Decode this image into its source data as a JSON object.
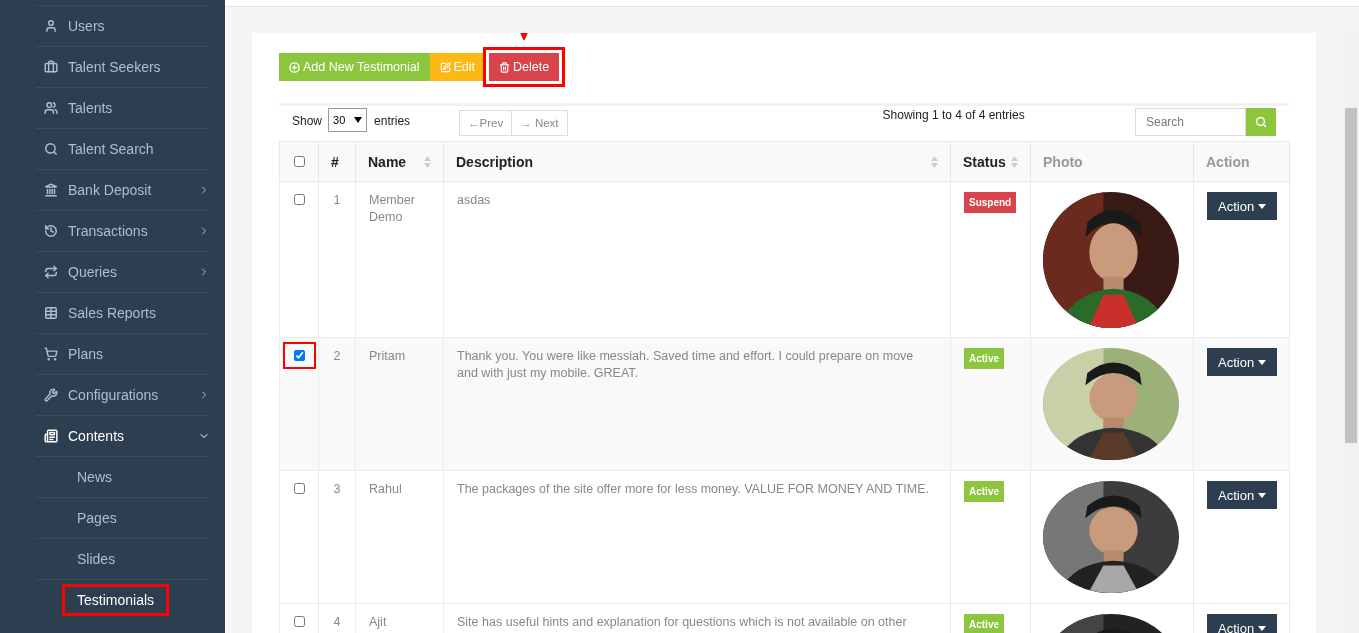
{
  "sidebar": {
    "items": [
      {
        "label": "Users",
        "submenu": false,
        "expanded": false
      },
      {
        "label": "Talent Seekers",
        "submenu": false,
        "expanded": false
      },
      {
        "label": "Talents",
        "submenu": false,
        "expanded": false
      },
      {
        "label": "Talent Search",
        "submenu": false,
        "expanded": false
      },
      {
        "label": "Bank Deposit",
        "submenu": true,
        "expanded": false
      },
      {
        "label": "Transactions",
        "submenu": true,
        "expanded": false
      },
      {
        "label": "Queries",
        "submenu": true,
        "expanded": false
      },
      {
        "label": "Sales Reports",
        "submenu": false,
        "expanded": false
      },
      {
        "label": "Plans",
        "submenu": false,
        "expanded": false
      },
      {
        "label": "Configurations",
        "submenu": true,
        "expanded": false
      },
      {
        "label": "Contents",
        "submenu": true,
        "expanded": true,
        "children": [
          {
            "label": "News",
            "selected": false,
            "highlighted": false
          },
          {
            "label": "Pages",
            "selected": false,
            "highlighted": false
          },
          {
            "label": "Slides",
            "selected": false,
            "highlighted": false
          },
          {
            "label": "Testimonials",
            "selected": true,
            "highlighted": true
          }
        ]
      }
    ]
  },
  "toolbar": {
    "buttons": [
      {
        "kind": "add",
        "label": "Add New Testimonial",
        "highlighted": false
      },
      {
        "kind": "edit",
        "label": "Edit",
        "highlighted": false
      },
      {
        "kind": "delete",
        "label": "Delete",
        "highlighted": true
      }
    ]
  },
  "controls": {
    "show_label": "Show",
    "page_size": "30",
    "entries_label": "entries",
    "prev": "←Prev",
    "next": "→ Next",
    "info": "Showing 1 to 4 of 4 entries",
    "search": {
      "placeholder": "Search"
    }
  },
  "table": {
    "columns": [
      {
        "kind": "checkbox",
        "checked": false
      },
      {
        "kind": "text",
        "label": "#",
        "sortable": false,
        "muted": false
      },
      {
        "kind": "text",
        "label": "Name",
        "sortable": true,
        "muted": false
      },
      {
        "kind": "text",
        "label": "Description",
        "sortable": true,
        "muted": false
      },
      {
        "kind": "text",
        "label": "Status",
        "sortable": true,
        "muted": false
      },
      {
        "kind": "text",
        "label": "Photo",
        "sortable": false,
        "muted": true
      },
      {
        "kind": "text",
        "label": "Action",
        "sortable": false,
        "muted": true
      }
    ],
    "rows": [
      {
        "checked": false,
        "highlighted": false,
        "number": "1",
        "name": "Member Demo",
        "description": "asdas",
        "status": {
          "label": "Suspend",
          "kind": "suspend"
        },
        "action": "Action"
      },
      {
        "checked": true,
        "highlighted": true,
        "number": "2",
        "name": "Pritam",
        "description": "Thank you. You were like messiah. Saved time and effort. I could prepare on move and with just my mobile. GREAT.",
        "status": {
          "label": "Active",
          "kind": "active"
        },
        "action": "Action"
      },
      {
        "checked": false,
        "highlighted": false,
        "number": "3",
        "name": "Rahul",
        "description": "The packages of the site offer more for less money. VALUE FOR MONEY AND TIME.",
        "status": {
          "label": "Active",
          "kind": "active"
        },
        "action": "Action"
      },
      {
        "checked": false,
        "highlighted": false,
        "number": "4",
        "name": "Ajit",
        "description": "Site has useful hints and explanation for questions which is not available on other",
        "status": {
          "label": "Active",
          "kind": "active"
        },
        "action": "Action"
      }
    ]
  }
}
